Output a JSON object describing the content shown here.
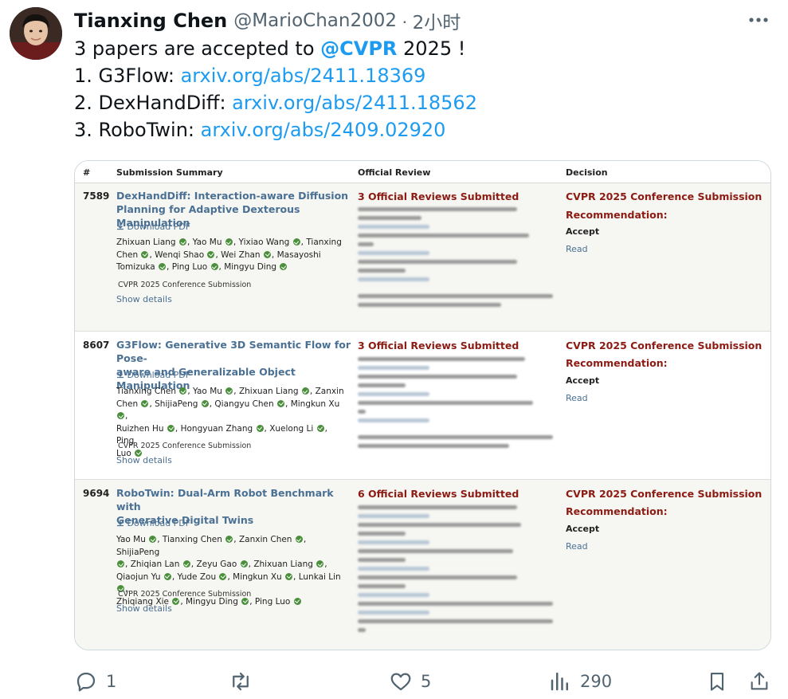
{
  "tweet": {
    "author_name": "Tianxing Chen",
    "handle": "@MarioChan2002",
    "separator": "·",
    "time": "2小时",
    "text": {
      "line1_pre": "3 papers are accepted to ",
      "line1_mention": "@CVPR",
      "line1_post": "  2025 !",
      "line2_pre": "1. G3Flow: ",
      "line2_link": "arxiv.org/abs/2411.18369",
      "line3_pre": "2. DexHandDiff: ",
      "line3_link": "arxiv.org/abs/2411.18562",
      "line4_pre": "3. RoboTwin: ",
      "line4_link": "arxiv.org/abs/2409.02920"
    }
  },
  "table": {
    "headers": {
      "num": "#",
      "summary": "Submission Summary",
      "review": "Official Review",
      "decision": "Decision"
    },
    "rows": [
      {
        "num": "7589",
        "title_l1": "DexHandDiff: Interaction-aware Diffusion",
        "title_l2": "Planning for Adaptive Dexterous Manipulation",
        "download": "Download PDF",
        "authors_l1": [
          "Zhixuan Liang",
          "Yao Mu",
          "Yixiao Wang",
          "Tianxing"
        ],
        "authors_l2": [
          "Chen",
          "Wenqi Shao",
          "Wei Zhan",
          "Masayoshi"
        ],
        "authors_l3": [
          "Tomizuka",
          "Ping Luo",
          "Mingyu Ding"
        ],
        "venue": "CVPR 2025 Conference Submission",
        "details": "Show details",
        "reviews": "3 Official Reviews Submitted",
        "decision_venue": "CVPR 2025 Conference Submission",
        "decision_label": "Recommendation:",
        "decision_value": "Accept",
        "read": "Read"
      },
      {
        "num": "8607",
        "title_l1": "G3Flow: Generative 3D Semantic Flow for Pose-",
        "title_l2": "aware and Generalizable Object Manipulation",
        "download": "Download PDF",
        "authors_l1": [
          "Tianxing Chen",
          "Yao Mu",
          "Zhixuan Liang",
          "Zanxin"
        ],
        "authors_l2": [
          "Chen",
          "ShijiaPeng",
          "Qiangyu Chen",
          "Mingkun Xu"
        ],
        "authors_l3": [
          "Ruizhen Hu",
          "Hongyuan Zhang",
          "Xuelong Li",
          "Ping"
        ],
        "authors_l4": [
          "Luo"
        ],
        "venue": "CVPR 2025 Conference Submission",
        "details": "Show details",
        "reviews": "3 Official Reviews Submitted",
        "decision_venue": "CVPR 2025 Conference Submission",
        "decision_label": "Recommendation:",
        "decision_value": "Accept",
        "read": "Read"
      },
      {
        "num": "9694",
        "title_l1": "RoboTwin: Dual-Arm Robot Benchmark with",
        "title_l2": "Generative Digital Twins",
        "download": "Download PDF",
        "authors_l1": [
          "Yao Mu",
          "Tianxing Chen",
          "Zanxin Chen",
          "ShijiaPeng"
        ],
        "authors_l2": [
          "",
          "Zhiqian Lan",
          "Zeyu Gao",
          "Zhixuan Liang"
        ],
        "authors_l3": [
          "Qiaojun Yu",
          "Yude Zou",
          "Mingkun Xu",
          "Lunkai Lin"
        ],
        "authors_l4": [
          "Zhiqiang Xie",
          "Mingyu Ding",
          "Ping Luo"
        ],
        "venue": "CVPR 2025 Conference Submission",
        "details": "Show details",
        "reviews": "6 Official Reviews Submitted",
        "decision_venue": "CVPR 2025 Conference Submission",
        "decision_label": "Recommendation:",
        "decision_value": "Accept",
        "read": "Read"
      }
    ]
  },
  "actions": {
    "replies": "1",
    "retweets": "",
    "likes": "5",
    "views": "290"
  },
  "colors": {
    "link": "#1d9bf0",
    "paper_title": "#4a7094",
    "review_red": "#8c1b13",
    "verified_green": "#4b8f3d"
  }
}
